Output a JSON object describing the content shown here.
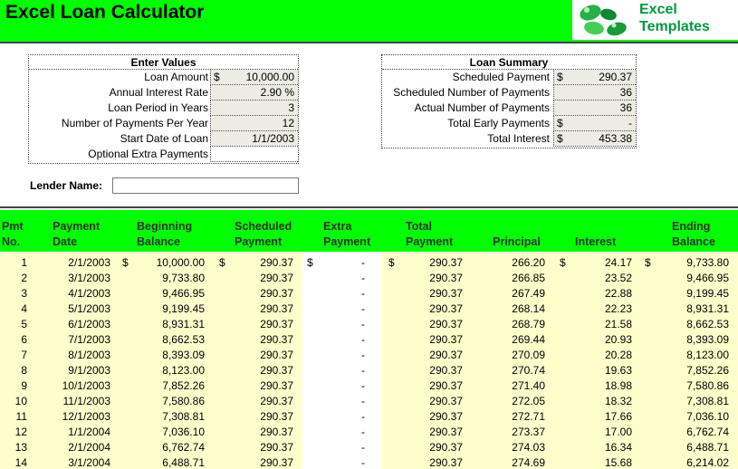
{
  "header": {
    "title": "Excel Loan Calculator",
    "logo_line1": "Excel",
    "logo_line2": "Templates"
  },
  "enter_values": {
    "title": "Enter Values",
    "rows": [
      {
        "label": "Loan Amount",
        "currency": "$",
        "value": "10,000.00"
      },
      {
        "label": "Annual Interest Rate",
        "currency": "",
        "value": "2.90  %"
      },
      {
        "label": "Loan Period in Years",
        "currency": "",
        "value": "3"
      },
      {
        "label": "Number of Payments Per Year",
        "currency": "",
        "value": "12"
      },
      {
        "label": "Start Date of Loan",
        "currency": "",
        "value": "1/1/2003"
      },
      {
        "label": "Optional Extra Payments",
        "currency": "",
        "value": ""
      }
    ]
  },
  "loan_summary": {
    "title": "Loan Summary",
    "rows": [
      {
        "label": "Scheduled Payment",
        "currency": "$",
        "value": "290.37"
      },
      {
        "label": "Scheduled Number of Payments",
        "currency": "",
        "value": "36"
      },
      {
        "label": "Actual Number of Payments",
        "currency": "",
        "value": "36"
      },
      {
        "label": "Total Early Payments",
        "currency": "$",
        "value": "-"
      },
      {
        "label": "Total Interest",
        "currency": "$",
        "value": "453.38"
      }
    ]
  },
  "lender": {
    "label": "Lender Name:",
    "value": ""
  },
  "schedule": {
    "headers": {
      "pmt_no_1": "Pmt",
      "pmt_no_2": "No.",
      "date_1": "Payment",
      "date_2": "Date",
      "beg_1": "Beginning",
      "beg_2": "Balance",
      "sched_1": "Scheduled",
      "sched_2": "Payment",
      "extra_1": "Extra",
      "extra_2": "Payment",
      "total_1": "Total",
      "total_2": "Payment",
      "principal": "Principal",
      "interest": "Interest",
      "end_1": "Ending",
      "end_2": "Balance"
    },
    "currency_symbol": "$",
    "rows": [
      [
        "1",
        "2/1/2003",
        "10,000.00",
        "290.37",
        "-",
        "290.37",
        "266.20",
        "24.17",
        "9,733.80"
      ],
      [
        "2",
        "3/1/2003",
        "9,733.80",
        "290.37",
        "-",
        "290.37",
        "266.85",
        "23.52",
        "9,466.95"
      ],
      [
        "3",
        "4/1/2003",
        "9,466.95",
        "290.37",
        "-",
        "290.37",
        "267.49",
        "22.88",
        "9,199.45"
      ],
      [
        "4",
        "5/1/2003",
        "9,199.45",
        "290.37",
        "-",
        "290.37",
        "268.14",
        "22.23",
        "8,931.31"
      ],
      [
        "5",
        "6/1/2003",
        "8,931.31",
        "290.37",
        "-",
        "290.37",
        "268.79",
        "21.58",
        "8,662.53"
      ],
      [
        "6",
        "7/1/2003",
        "8,662.53",
        "290.37",
        "-",
        "290.37",
        "269.44",
        "20.93",
        "8,393.09"
      ],
      [
        "7",
        "8/1/2003",
        "8,393.09",
        "290.37",
        "-",
        "290.37",
        "270.09",
        "20.28",
        "8,123.00"
      ],
      [
        "8",
        "9/1/2003",
        "8,123.00",
        "290.37",
        "-",
        "290.37",
        "270.74",
        "19.63",
        "7,852.26"
      ],
      [
        "9",
        "10/1/2003",
        "7,852.26",
        "290.37",
        "-",
        "290.37",
        "271.40",
        "18.98",
        "7,580.86"
      ],
      [
        "10",
        "11/1/2003",
        "7,580.86",
        "290.37",
        "-",
        "290.37",
        "272.05",
        "18.32",
        "7,308.81"
      ],
      [
        "11",
        "12/1/2003",
        "7,308.81",
        "290.37",
        "-",
        "290.37",
        "272.71",
        "17.66",
        "7,036.10"
      ],
      [
        "12",
        "1/1/2004",
        "7,036.10",
        "290.37",
        "-",
        "290.37",
        "273.37",
        "17.00",
        "6,762.74"
      ],
      [
        "13",
        "2/1/2004",
        "6,762.74",
        "290.37",
        "-",
        "290.37",
        "274.03",
        "16.34",
        "6,488.71"
      ],
      [
        "14",
        "3/1/2004",
        "6,488.71",
        "290.37",
        "-",
        "290.37",
        "274.69",
        "15.68",
        "6,214.02"
      ]
    ]
  }
}
